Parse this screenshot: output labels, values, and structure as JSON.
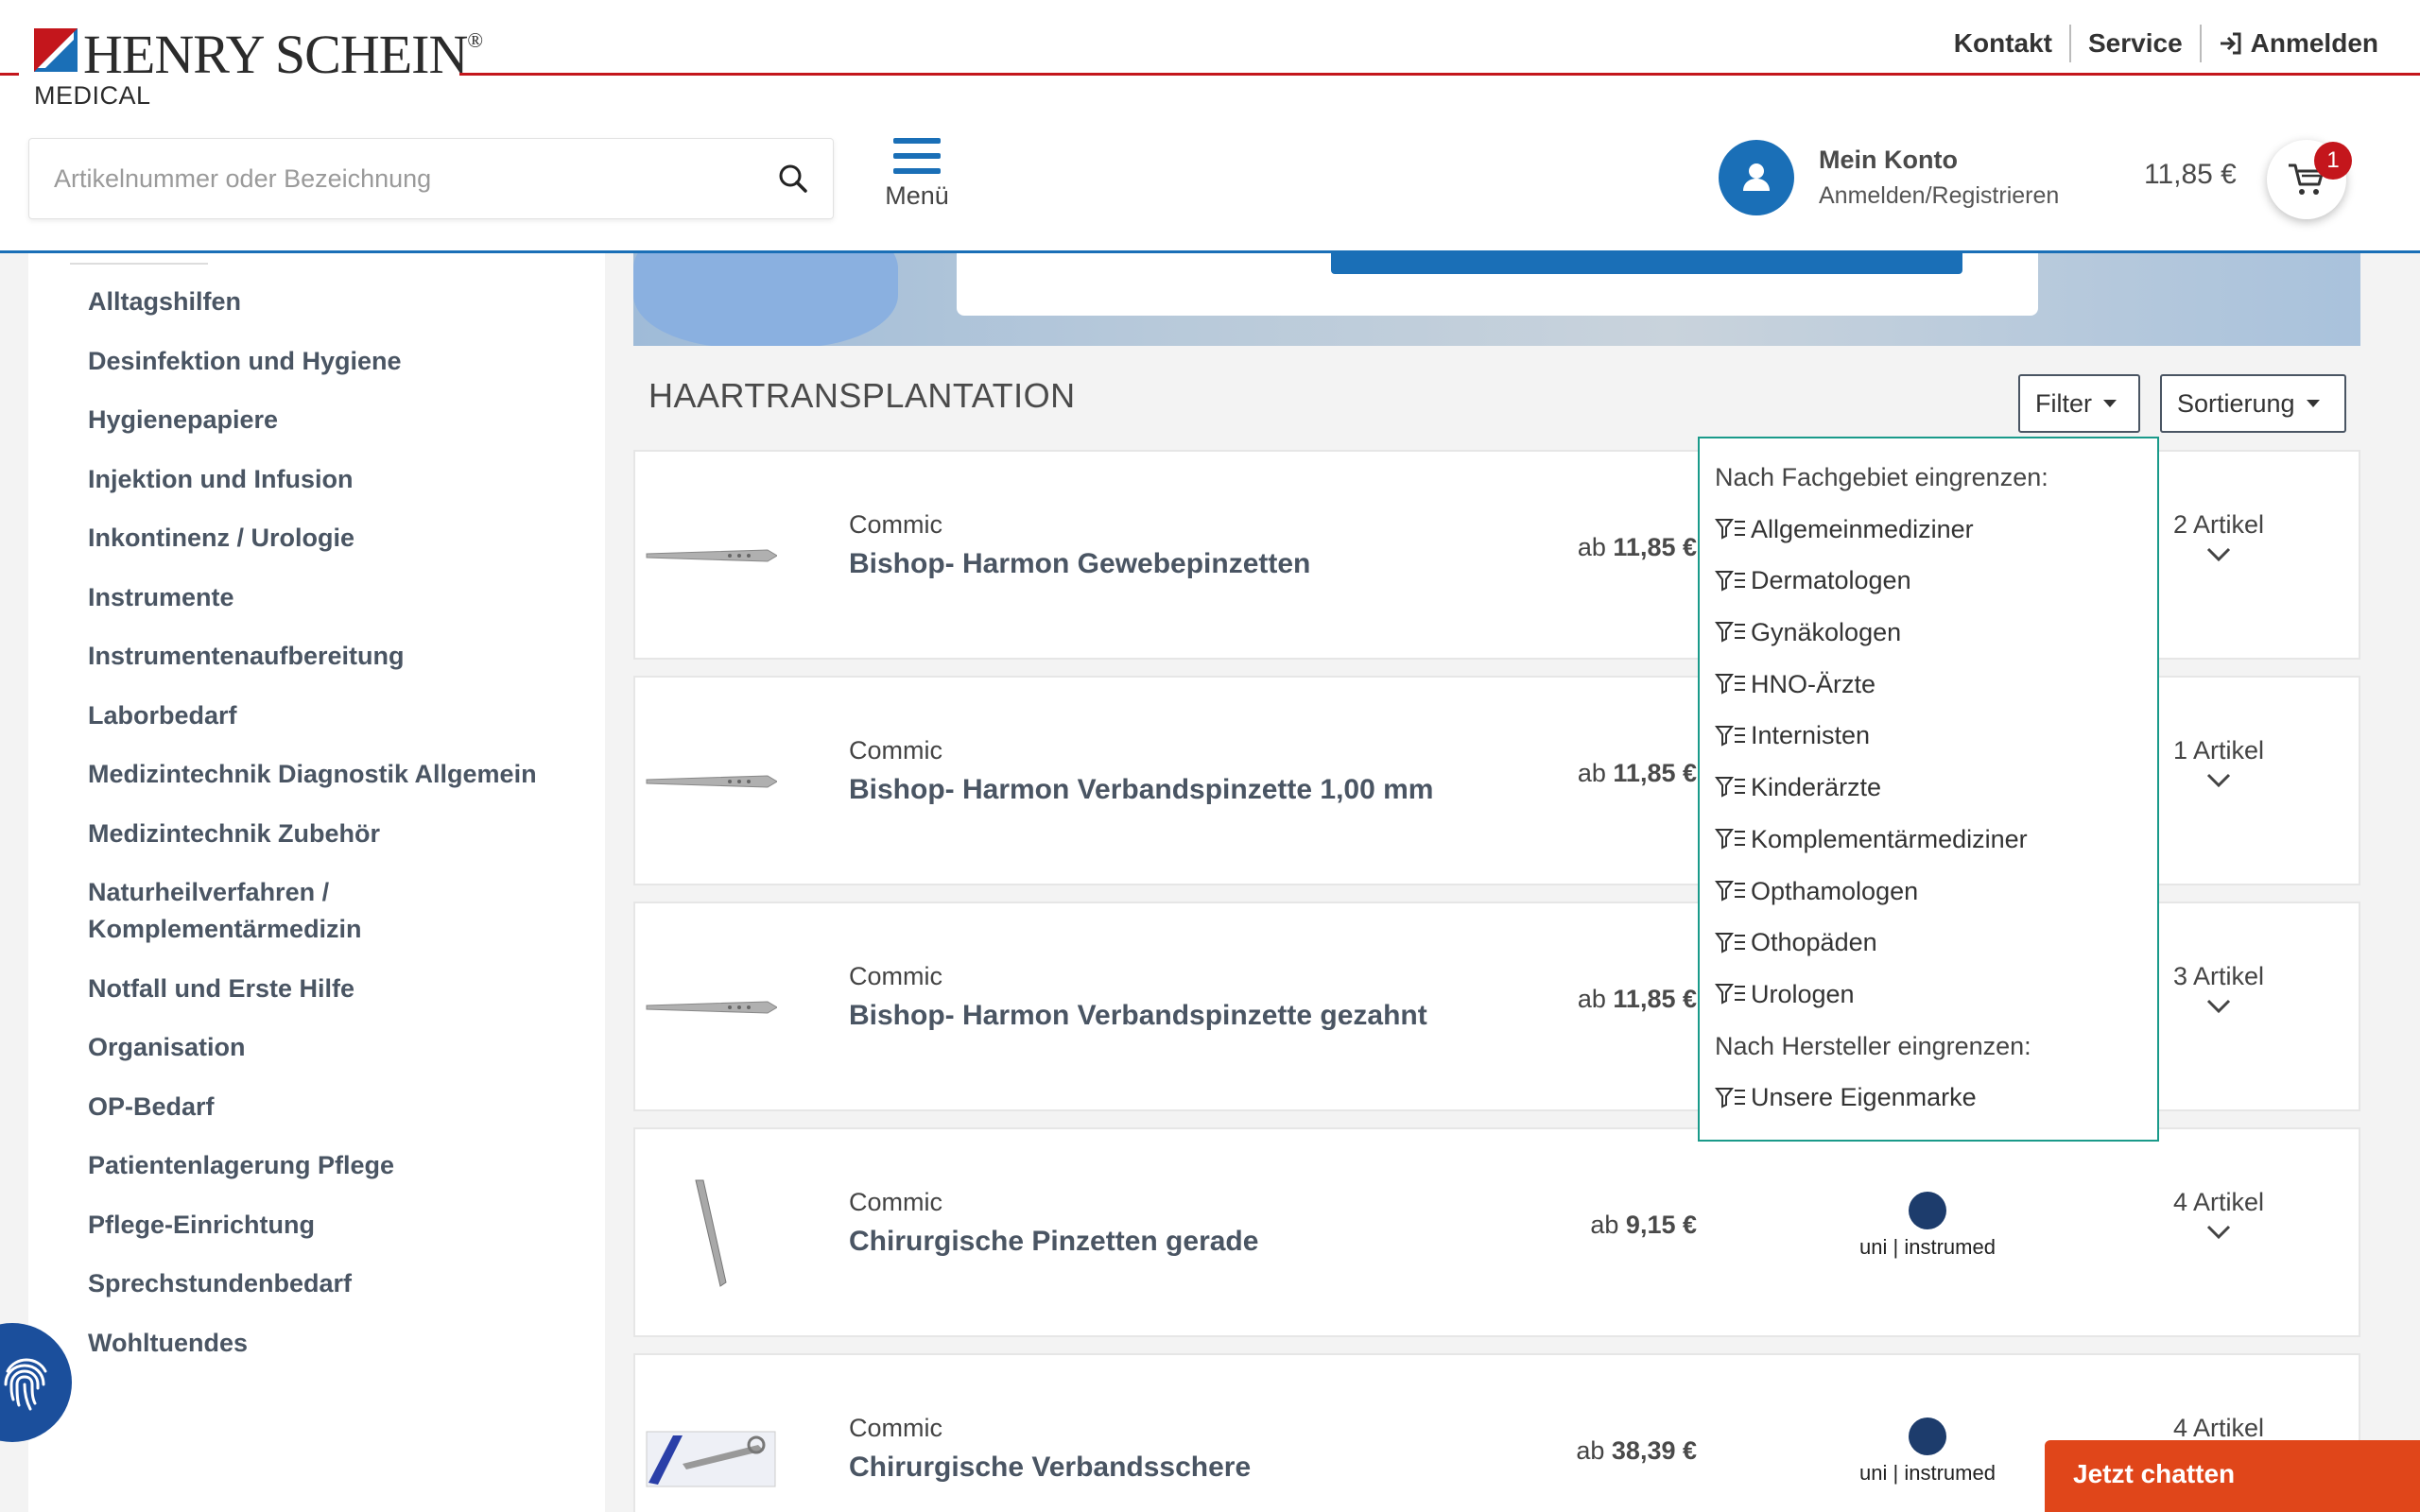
{
  "header": {
    "logo": {
      "name": "HENRY SCHEIN",
      "registered": "®",
      "sub": "MEDICAL"
    },
    "topnav": {
      "kontakt": "Kontakt",
      "service": "Service",
      "login": "Anmelden"
    },
    "search": {
      "placeholder": "Artikelnummer oder Bezeichnung"
    },
    "menu": {
      "label": "Menü"
    },
    "account": {
      "title": "Mein Konto",
      "subtitle": "Anmelden/Registrieren"
    },
    "cart": {
      "total": "11,85 €",
      "badge": "1"
    }
  },
  "sidebar": {
    "items": [
      "Alltagshilfen",
      "Desinfektion und Hygiene",
      "Hygienepapiere",
      "Injektion und Infusion",
      "Inkontinenz / Urologie",
      "Instrumente",
      "Instrumentenaufbereitung",
      "Laborbedarf",
      "Medizintechnik Diagnostik Allgemein",
      "Medizintechnik Zubehör",
      "Naturheilverfahren / Komplementärmedizin",
      "Notfall und Erste Hilfe",
      "Organisation",
      "OP-Bedarf",
      "Patientenlagerung Pflege",
      "Pflege-Einrichtung",
      "Sprechstundenbedarf",
      "Wohltuendes"
    ]
  },
  "main": {
    "title": "HAARTRANSPLANTATION",
    "filter_label": "Filter",
    "sort_label": "Sortierung",
    "products": [
      {
        "brand": "Commic",
        "name": "Bishop- Harmon Gewebepinzetten",
        "price_prefix": "ab",
        "price": "11,85 €",
        "count": "2 Artikel",
        "manufacturer": ""
      },
      {
        "brand": "Commic",
        "name": "Bishop- Harmon Verbandspinzette 1,00 mm",
        "price_prefix": "ab",
        "price": "11,85 €",
        "count": "1 Artikel",
        "manufacturer": ""
      },
      {
        "brand": "Commic",
        "name": "Bishop- Harmon Verbandspinzette gezahnt",
        "price_prefix": "ab",
        "price": "11,85 €",
        "count": "3 Artikel",
        "manufacturer": ""
      },
      {
        "brand": "Commic",
        "name": "Chirurgische Pinzetten gerade",
        "price_prefix": "ab",
        "price": "9,15 €",
        "count": "4 Artikel",
        "manufacturer": "uni | instrumed"
      },
      {
        "brand": "Commic",
        "name": "Chirurgische Verbandsschere",
        "price_prefix": "ab",
        "price": "38,39 €",
        "count": "4 Artikel",
        "manufacturer": "uni | instrumed"
      }
    ]
  },
  "filter_dropdown": {
    "heading_specialty": "Nach Fachgebiet eingrenzen:",
    "specialties": [
      "Allgemeinmediziner",
      "Dermatologen",
      "Gynäkologen",
      "HNO-Ärzte",
      "Internisten",
      "Kinderärzte",
      "Komplementärmediziner",
      "Opthamologen",
      "Othopäden",
      "Urologen"
    ],
    "heading_manufacturer": "Nach Hersteller eingrenzen:",
    "manufacturers": [
      "Unsere Eigenmarke"
    ]
  },
  "chat": {
    "label": "Jetzt chatten"
  },
  "colors": {
    "primary": "#1a6fb7",
    "brand_red": "#c4161c",
    "chat": "#e0461a",
    "dropdown_border": "#1a9a8a"
  }
}
